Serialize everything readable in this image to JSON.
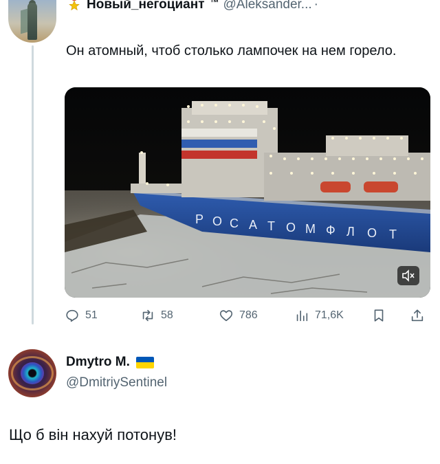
{
  "tweet": {
    "author_name": "Новый_негоциант",
    "author_suffix": "™",
    "author_handle": "@Aleksander...",
    "more": "·",
    "text": "Он атомный, чтоб столько лампочек на нем горело.",
    "media": {
      "hull_text": [
        "Р",
        "О",
        "С",
        "А",
        "Т",
        "О",
        "М",
        "Ф",
        "Л",
        "О",
        "Т"
      ]
    },
    "actions": {
      "replies": "51",
      "retweets": "58",
      "likes": "786",
      "views": "71,6K"
    }
  },
  "reply": {
    "author_name": "Dmytro M.",
    "author_handle": "@DmitriySentinel",
    "text": "Що б він нахуй потонув!"
  },
  "colors": {
    "text": "#0f1419",
    "muted": "#536471",
    "thread_line": "#cfd9de",
    "star": "#f4c20d",
    "flag_blue": "#0057b7",
    "flag_yellow": "#ffd500"
  }
}
